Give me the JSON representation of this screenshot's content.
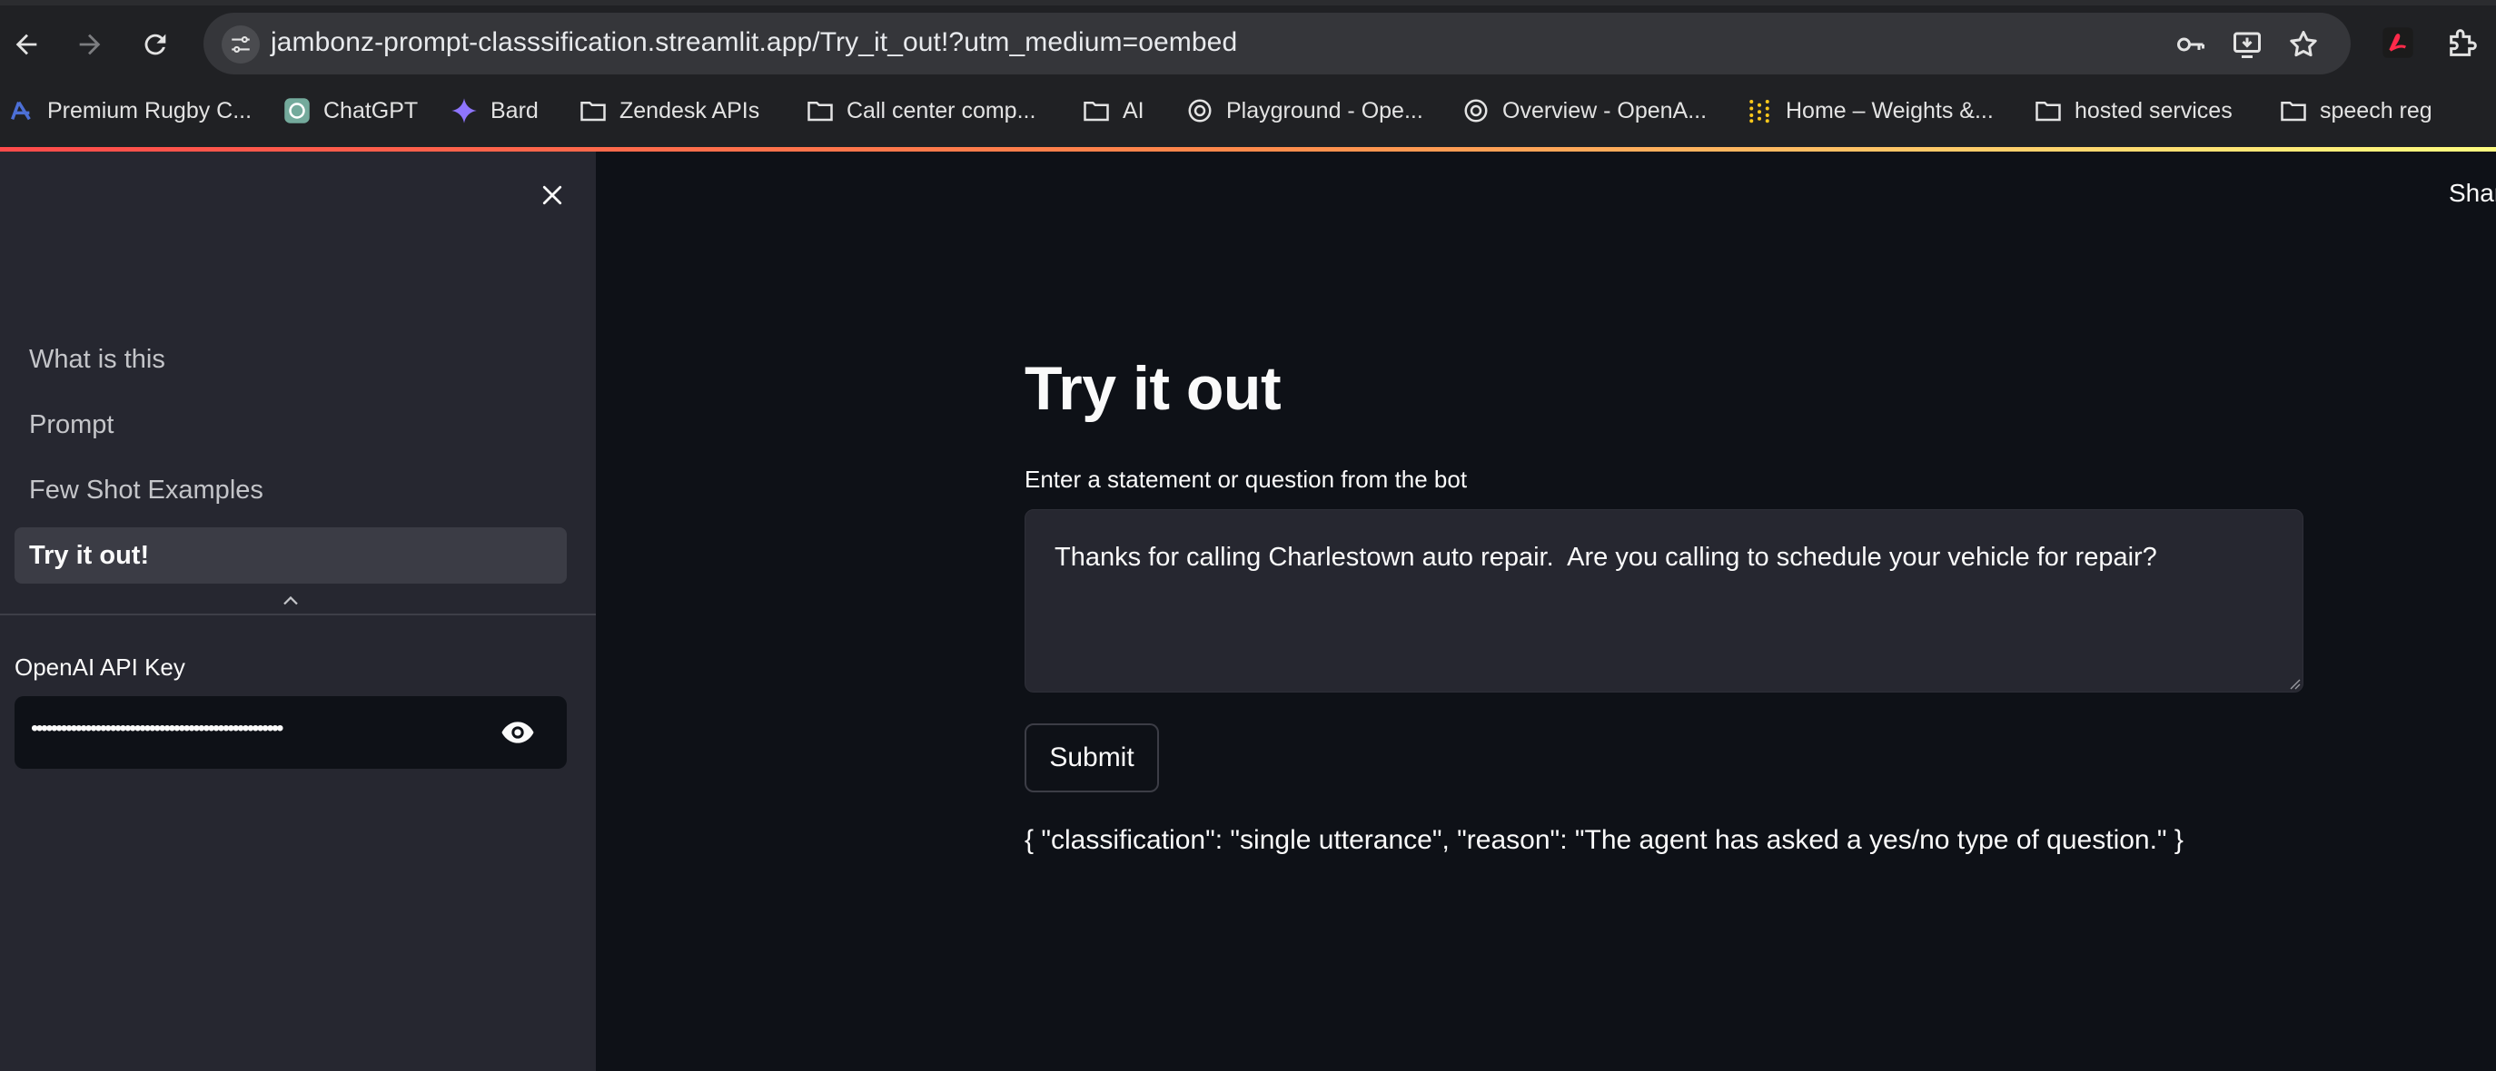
{
  "browser": {
    "url": "jambonz-prompt-classsification.streamlit.app/Try_it_out!?utm_medium=oembed",
    "nav_icons": [
      "back-arrow-icon",
      "forward-arrow-icon",
      "reload-icon"
    ],
    "omnibox_icons": [
      "site-info-icon",
      "password-key-icon",
      "install-app-icon",
      "bookmark-star-icon"
    ],
    "extension_icons": [
      "acrobat-extension-icon",
      "extensions-puzzle-icon"
    ],
    "bookmarks": [
      {
        "label": "Premium Rugby C...",
        "icon": "rugby-favicon"
      },
      {
        "label": "ChatGPT",
        "icon": "openai-favicon"
      },
      {
        "label": "Bard",
        "icon": "bard-sparkle-favicon"
      },
      {
        "label": "Zendesk APIs",
        "icon": "folder-icon"
      },
      {
        "label": "Call center comp...",
        "icon": "folder-icon"
      },
      {
        "label": "AI",
        "icon": "folder-icon"
      },
      {
        "label": "Playground - Ope...",
        "icon": "openai-favicon"
      },
      {
        "label": "Overview - OpenA...",
        "icon": "openai-favicon"
      },
      {
        "label": "Home – Weights &...",
        "icon": "wandb-favicon"
      },
      {
        "label": "hosted services",
        "icon": "folder-icon"
      },
      {
        "label": "speech reg",
        "icon": "folder-icon"
      }
    ]
  },
  "sidebar": {
    "nav": [
      {
        "label": "What is this",
        "active": false
      },
      {
        "label": "Prompt",
        "active": false
      },
      {
        "label": "Few Shot Examples",
        "active": false
      },
      {
        "label": "Try it out!",
        "active": true
      }
    ],
    "api_key": {
      "label": "OpenAI API Key",
      "value": "•••••••••••••••••••••••••••••••••••••••••••••••••••",
      "toggle_icon": "eye-icon"
    }
  },
  "main": {
    "share_label": "Shar",
    "title": "Try it out",
    "input_label": "Enter a statement or question from the bot",
    "input_value": "Thanks for calling Charlestown auto repair.  Are you calling to schedule your vehicle for repair?",
    "submit_label": "Submit",
    "result": "{ \"classification\": \"single utterance\", \"reason\": \"The agent has asked a yes/no type of question.\" }"
  },
  "colors": {
    "app_background": "#0e1117",
    "sidebar_background": "#262730",
    "accent_gradient_start": "#ff4b4b",
    "accent_gradient_end": "#fffd80",
    "text": "#fafafa"
  }
}
